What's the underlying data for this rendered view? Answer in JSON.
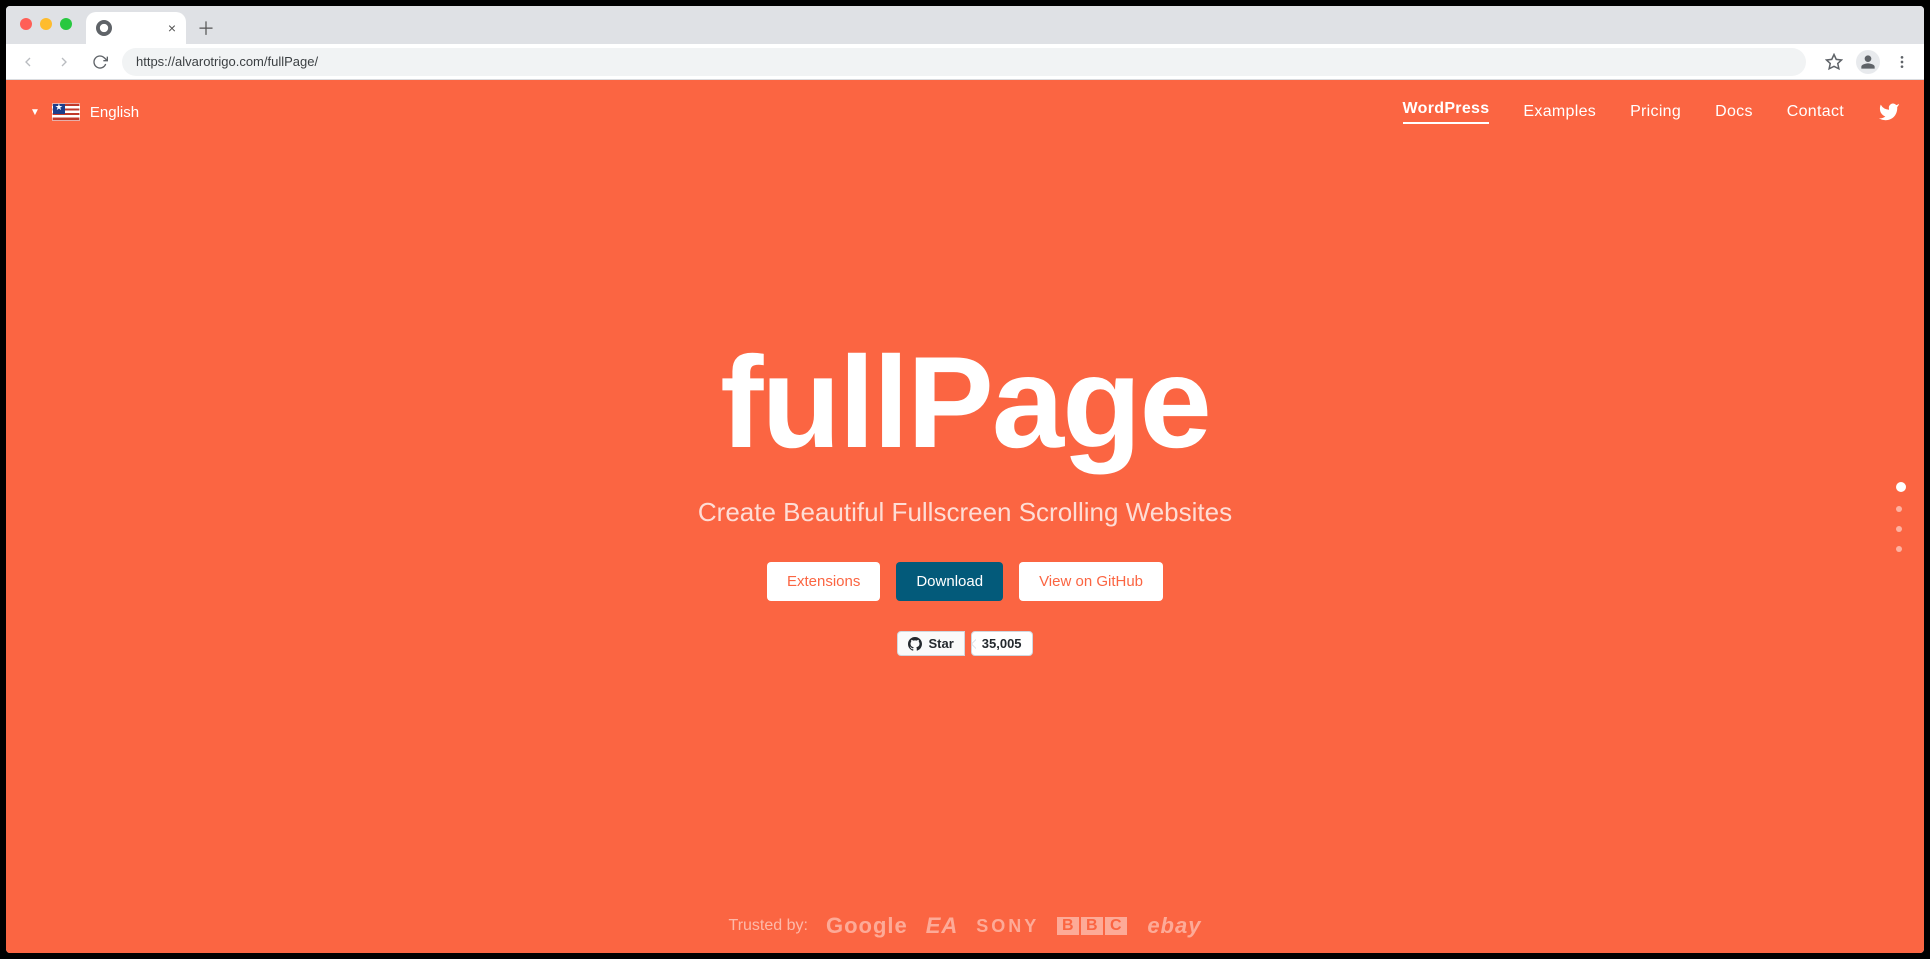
{
  "browser": {
    "tab_title": "",
    "url": "https://alvarotrigo.com/fullPage/"
  },
  "header": {
    "language": "English",
    "nav": [
      {
        "label": "WordPress",
        "active": true
      },
      {
        "label": "Examples",
        "active": false
      },
      {
        "label": "Pricing",
        "active": false
      },
      {
        "label": "Docs",
        "active": false
      },
      {
        "label": "Contact",
        "active": false
      }
    ]
  },
  "hero": {
    "title": "fullPage",
    "subtitle": "Create Beautiful Fullscreen Scrolling Websites",
    "buttons": {
      "extensions": "Extensions",
      "download": "Download",
      "github": "View on GitHub"
    },
    "github": {
      "star_label": "Star",
      "star_count": "35,005"
    }
  },
  "trusted": {
    "label": "Trusted by:",
    "brands": [
      "Google",
      "EA",
      "SONY",
      "BBC",
      "ebay"
    ]
  },
  "section_nav": {
    "count": 4,
    "active_index": 0
  },
  "colors": {
    "accent": "#fb6542",
    "dark_button": "#035a7a"
  }
}
